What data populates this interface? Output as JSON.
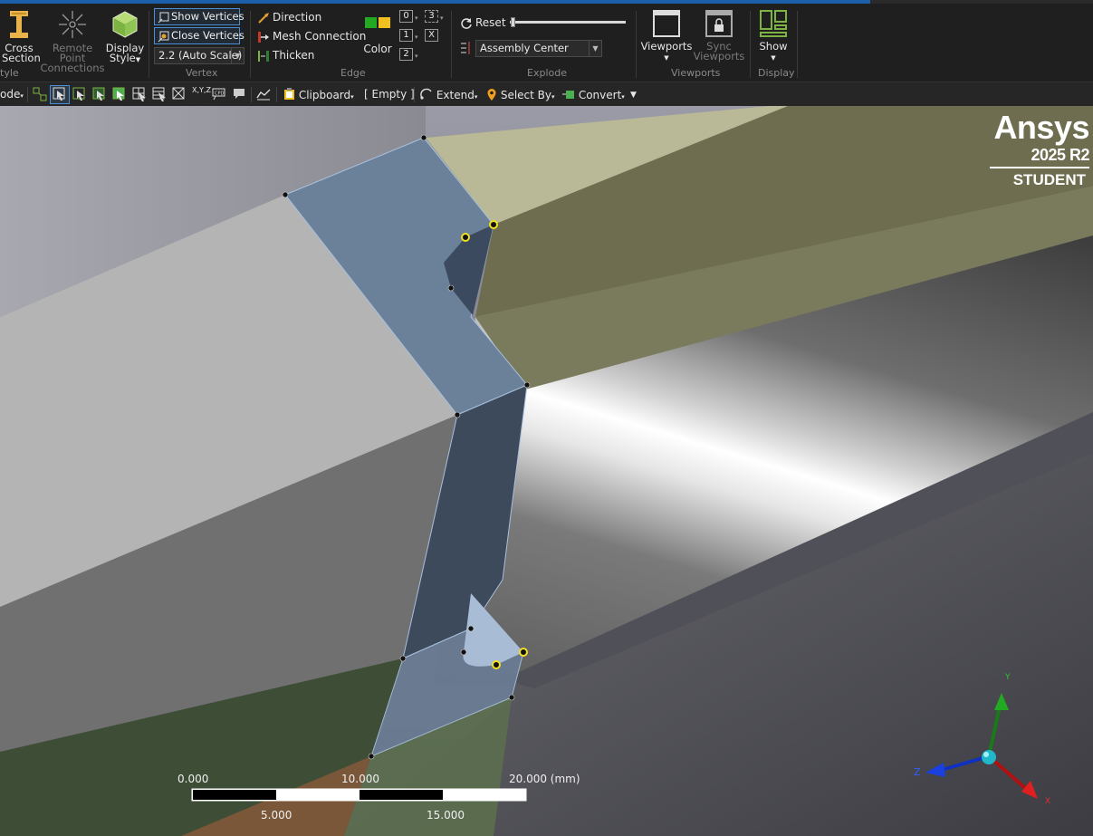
{
  "ribbon": {
    "style_group": {
      "cross_section": [
        "Cross",
        "Section"
      ],
      "remote_point": [
        "Remote Point",
        "Connections"
      ],
      "display_style": [
        "Display",
        "Style"
      ],
      "label": "tyle"
    },
    "vertex_group": {
      "show_vertices": "Show Vertices",
      "close_vertices": "Close Vertices",
      "scale_value": "2.2 (Auto Scale)",
      "label": "Vertex"
    },
    "edge_group": {
      "direction": "Direction",
      "mesh_connection": "Mesh Connection",
      "thicken": "Thicken",
      "color": "Color",
      "boxes": [
        "0",
        "1",
        "2",
        "3",
        "X"
      ],
      "label": "Edge"
    },
    "explode_group": {
      "reset": "Reset",
      "center": "Assembly Center",
      "label": "Explode"
    },
    "viewports_group": {
      "viewports": "Viewports",
      "sync": [
        "Sync",
        "Viewports"
      ],
      "label": "Viewports"
    },
    "display_group": {
      "show": "Show",
      "label": "Display"
    }
  },
  "toolbar": {
    "mode": "ode",
    "clipboard": "Clipboard",
    "empty": "[ Empty ]",
    "extend": "Extend",
    "select_by": "Select By",
    "convert": "Convert",
    "xyz": "X,Y,Z"
  },
  "logo": {
    "brand": "Ansys",
    "version": "2025 R2",
    "edition": "STUDENT"
  },
  "scale_bar": {
    "top_labels": [
      "0.000",
      "10.000",
      "20.000 (mm)"
    ],
    "bottom_labels": [
      "5.000",
      "15.000"
    ]
  },
  "triad": {
    "y": "Y",
    "z": "Z",
    "x": "X"
  },
  "colors": {
    "accent": "#4a8fd6",
    "surface_blue": "#6b8199",
    "highlight_vertex": "#f0e020"
  }
}
